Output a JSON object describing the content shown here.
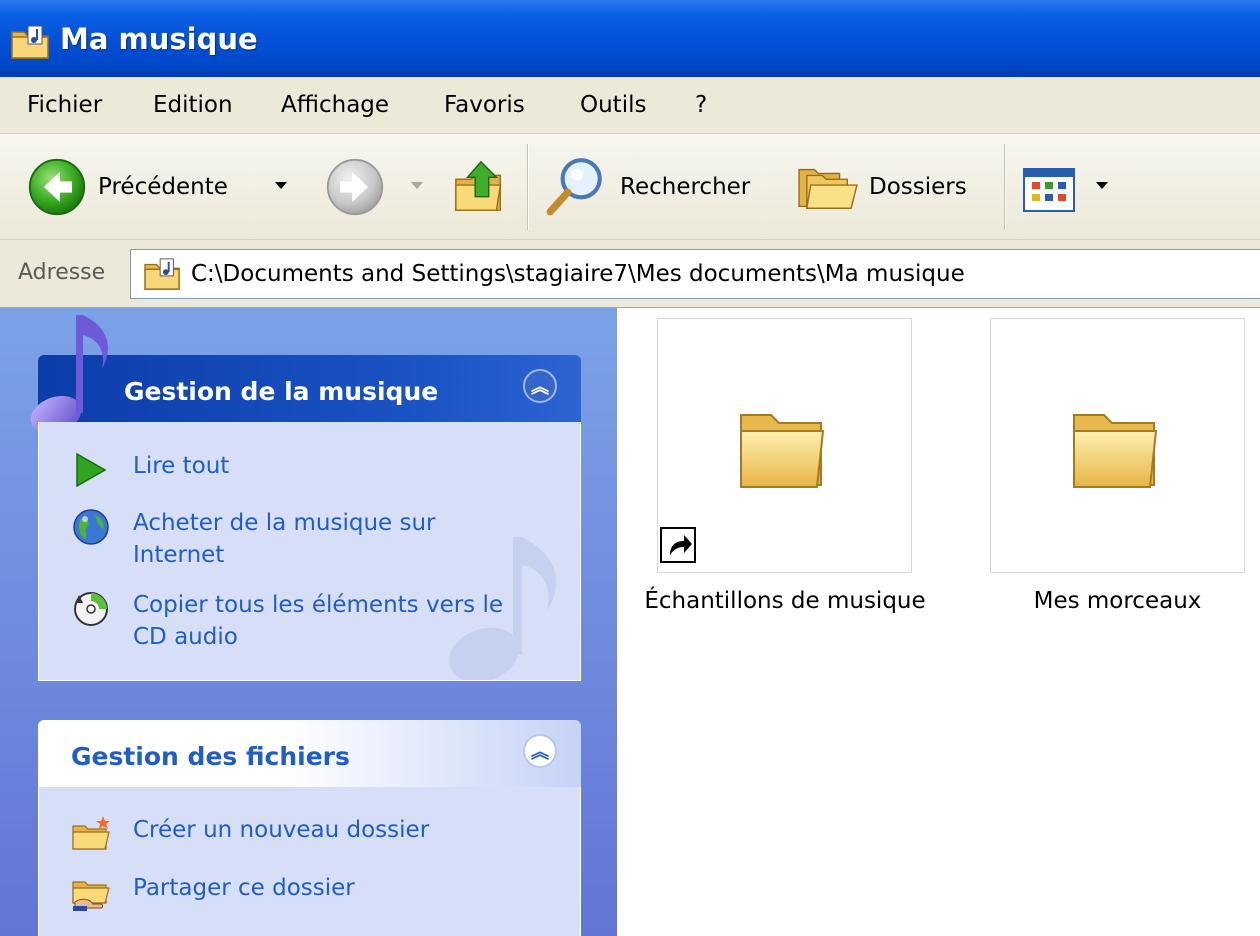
{
  "window": {
    "title": "Ma musique"
  },
  "menu": [
    "Fichier",
    "Edition",
    "Affichage",
    "Favoris",
    "Outils",
    "?"
  ],
  "toolbar": {
    "back_label": "Précédente",
    "search_label": "Rechercher",
    "folders_label": "Dossiers"
  },
  "address": {
    "label": "Adresse",
    "value": "C:\\Documents and Settings\\stagiaire7\\Mes documents\\Ma musique"
  },
  "tasks": {
    "music": {
      "title": "Gestion de la musique",
      "items": [
        {
          "icon": "play-icon",
          "label": "Lire tout"
        },
        {
          "icon": "globe-icon",
          "label": "Acheter de la musique sur Internet"
        },
        {
          "icon": "cd-copy-icon",
          "label": "Copier tous les éléments vers le CD audio"
        }
      ]
    },
    "files": {
      "title": "Gestion des fichiers",
      "items": [
        {
          "icon": "new-folder-icon",
          "label": "Créer un nouveau dossier"
        },
        {
          "icon": "share-folder-icon",
          "label": "Partager ce dossier"
        }
      ]
    }
  },
  "items": [
    {
      "label": "Échantillons de musique",
      "shortcut": true
    },
    {
      "label": "Mes morceaux",
      "shortcut": false
    }
  ],
  "colors": {
    "titlebar": "#0552d8",
    "taskpane": "#7ba2e7",
    "task_link": "#215dc6",
    "folder": "#f3d36b"
  }
}
